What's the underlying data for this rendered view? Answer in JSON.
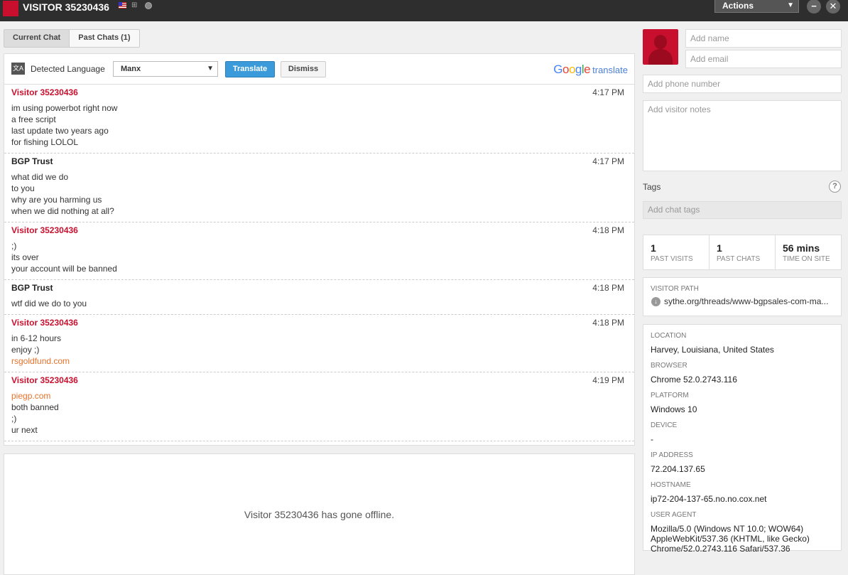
{
  "window": {
    "title": "VISITOR 35230436",
    "actions_label": "Actions",
    "minimize_label": "−",
    "close_label": "✕"
  },
  "tabs": [
    {
      "label": "Current Chat"
    },
    {
      "label": "Past Chats (1)"
    }
  ],
  "translate": {
    "detected_label": "Detected Language",
    "language": "Manx",
    "translate_label": "Translate",
    "dismiss_label": "Dismiss",
    "google_logo_colors": [
      "#4285f4",
      "#ea4335",
      "#fbbc05",
      "#4285f4",
      "#34a853",
      "#ea4335"
    ],
    "google_word": "Google",
    "translate_word": "translate"
  },
  "messages": [
    {
      "author": "Visitor 35230436",
      "role": "visitor",
      "time": "4:17 PM",
      "lines": [
        {
          "text": "im using powerbot right now"
        },
        {
          "text": "a free script"
        },
        {
          "text": "last update two years ago"
        },
        {
          "text": "for fishing LOLOL"
        }
      ]
    },
    {
      "author": "BGP Trust",
      "role": "agent",
      "time": "4:17 PM",
      "lines": [
        {
          "text": "what did we do"
        },
        {
          "text": "to you"
        },
        {
          "text": "why are you harming us"
        },
        {
          "text": "when we did nothing at all?"
        }
      ]
    },
    {
      "author": "Visitor 35230436",
      "role": "visitor",
      "time": "4:18 PM",
      "lines": [
        {
          "text": ";)"
        },
        {
          "text": "its over"
        },
        {
          "text": "your account will be banned"
        }
      ]
    },
    {
      "author": "BGP Trust",
      "role": "agent",
      "time": "4:18 PM",
      "lines": [
        {
          "text": "wtf did we do to you"
        }
      ]
    },
    {
      "author": "Visitor 35230436",
      "role": "visitor",
      "time": "4:18 PM",
      "lines": [
        {
          "text": "in 6-12 hours"
        },
        {
          "text": "enjoy ;)"
        },
        {
          "text": "rsgoldfund.com",
          "link": true
        }
      ]
    },
    {
      "author": "Visitor 35230436",
      "role": "visitor",
      "time": "4:19 PM",
      "lines": [
        {
          "text": "piegp.com",
          "link": true
        },
        {
          "text": "both banned"
        },
        {
          "text": ";)"
        },
        {
          "text": "ur next"
        }
      ]
    }
  ],
  "offline_message": "Visitor 35230436 has gone offline.",
  "sidebar": {
    "name_placeholder": "Add name",
    "email_placeholder": "Add email",
    "phone_placeholder": "Add phone number",
    "notes_placeholder": "Add visitor notes",
    "tags_label": "Tags",
    "tags_help": "?",
    "tags_placeholder": "Add chat tags",
    "stats": [
      {
        "num": "1",
        "label": "PAST VISITS"
      },
      {
        "num": "1",
        "label": "PAST CHATS"
      },
      {
        "num": "56 mins",
        "label": "TIME ON SITE"
      }
    ],
    "visitor_path_label": "VISITOR PATH",
    "visitor_path": "sythe.org/threads/www-bgpsales-com-ma...",
    "info": [
      {
        "label": "LOCATION",
        "value": "Harvey, Louisiana, United States"
      },
      {
        "label": "BROWSER",
        "value": "Chrome 52.0.2743.116"
      },
      {
        "label": "PLATFORM",
        "value": "Windows 10"
      },
      {
        "label": "DEVICE",
        "value": "-"
      },
      {
        "label": "IP ADDRESS",
        "value": "72.204.137.65"
      },
      {
        "label": "HOSTNAME",
        "value": "ip72-204-137-65.no.no.cox.net"
      },
      {
        "label": "USER AGENT",
        "value": "Mozilla/5.0 (Windows NT 10.0; WOW64) AppleWebKit/537.36 (KHTML, like Gecko) Chrome/52.0.2743.116 Safari/537.36"
      }
    ]
  },
  "colors": {
    "visitor": "#c8102e",
    "link": "#e8722b",
    "translate_button": "#3b9ad9"
  }
}
